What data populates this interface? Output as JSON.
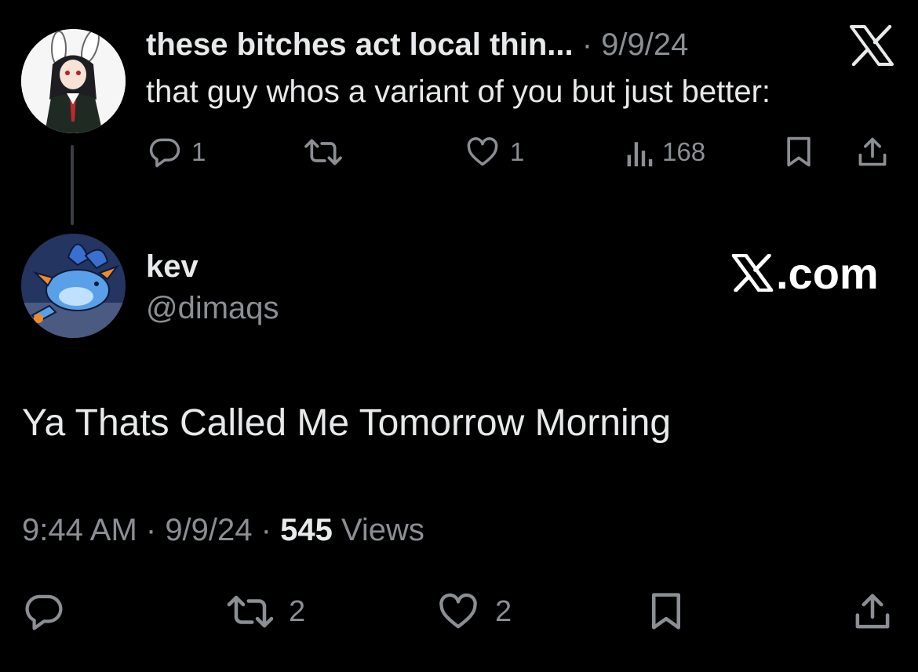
{
  "parent_tweet": {
    "display_name": "these bitches act local thin...",
    "separator": "·",
    "date": "9/9/24",
    "text": "that guy whos a variant of you but just better:",
    "actions": {
      "replies": "1",
      "reposts": "",
      "likes": "1",
      "views": "168"
    }
  },
  "tweet": {
    "display_name": "kev",
    "handle": "@dimaqs",
    "brand": ".com",
    "text": "Ya Thats Called Me Tomorrow Morning",
    "time": "9:44 AM",
    "sep1": " · ",
    "date": "9/9/24",
    "sep2": " · ",
    "views_count": "545",
    "views_label": " Views",
    "actions": {
      "replies": "",
      "reposts": "2",
      "likes": "2"
    }
  },
  "colors": {
    "background": "#000000",
    "primary_text": "#e7e9ea",
    "secondary_text": "#8b8f94"
  },
  "icons": [
    "x-logo-icon",
    "reply-icon",
    "repost-icon",
    "like-icon",
    "views-icon",
    "bookmark-icon",
    "share-icon"
  ]
}
